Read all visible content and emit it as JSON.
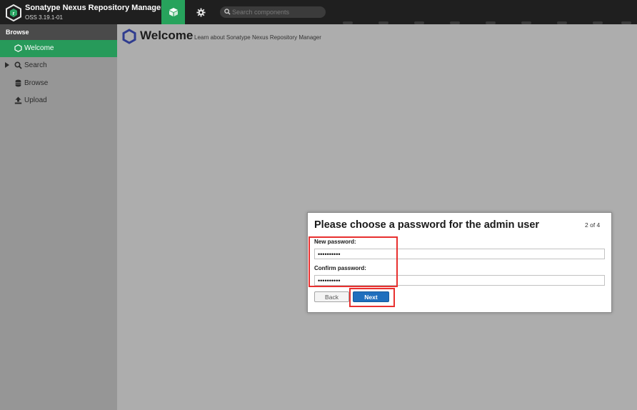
{
  "header": {
    "app_title": "Sonatype Nexus Repository Manager",
    "app_version": "OSS 3.19.1-01",
    "modes": [
      {
        "name": "browse-mode",
        "icon": "cube-icon",
        "active": true
      },
      {
        "name": "administration-mode",
        "icon": "gear-icon",
        "active": false
      }
    ],
    "search_placeholder": "Search components"
  },
  "sidebar": {
    "section_title": "Browse",
    "items": [
      {
        "label": "Welcome",
        "icon": "hexagon-icon",
        "active": true
      },
      {
        "label": "Search",
        "icon": "search-icon",
        "expandable": true
      },
      {
        "label": "Browse",
        "icon": "database-icon"
      },
      {
        "label": "Upload",
        "icon": "upload-icon"
      }
    ]
  },
  "page": {
    "title": "Welcome",
    "subtitle": "Learn about Sonatype Nexus Repository Manager"
  },
  "dialog": {
    "title": "Please choose a password for the admin user",
    "step": "2 of 4",
    "new_password_label": "New password:",
    "new_password_value": "••••••••••",
    "confirm_password_label": "Confirm password:",
    "confirm_password_value": "••••••••••",
    "back_label": "Back",
    "next_label": "Next"
  },
  "colors": {
    "accent_green": "#279a5a",
    "primary_blue": "#1f6fbd",
    "highlight_red": "#e8302f",
    "header_bg": "#1f1f1f"
  }
}
